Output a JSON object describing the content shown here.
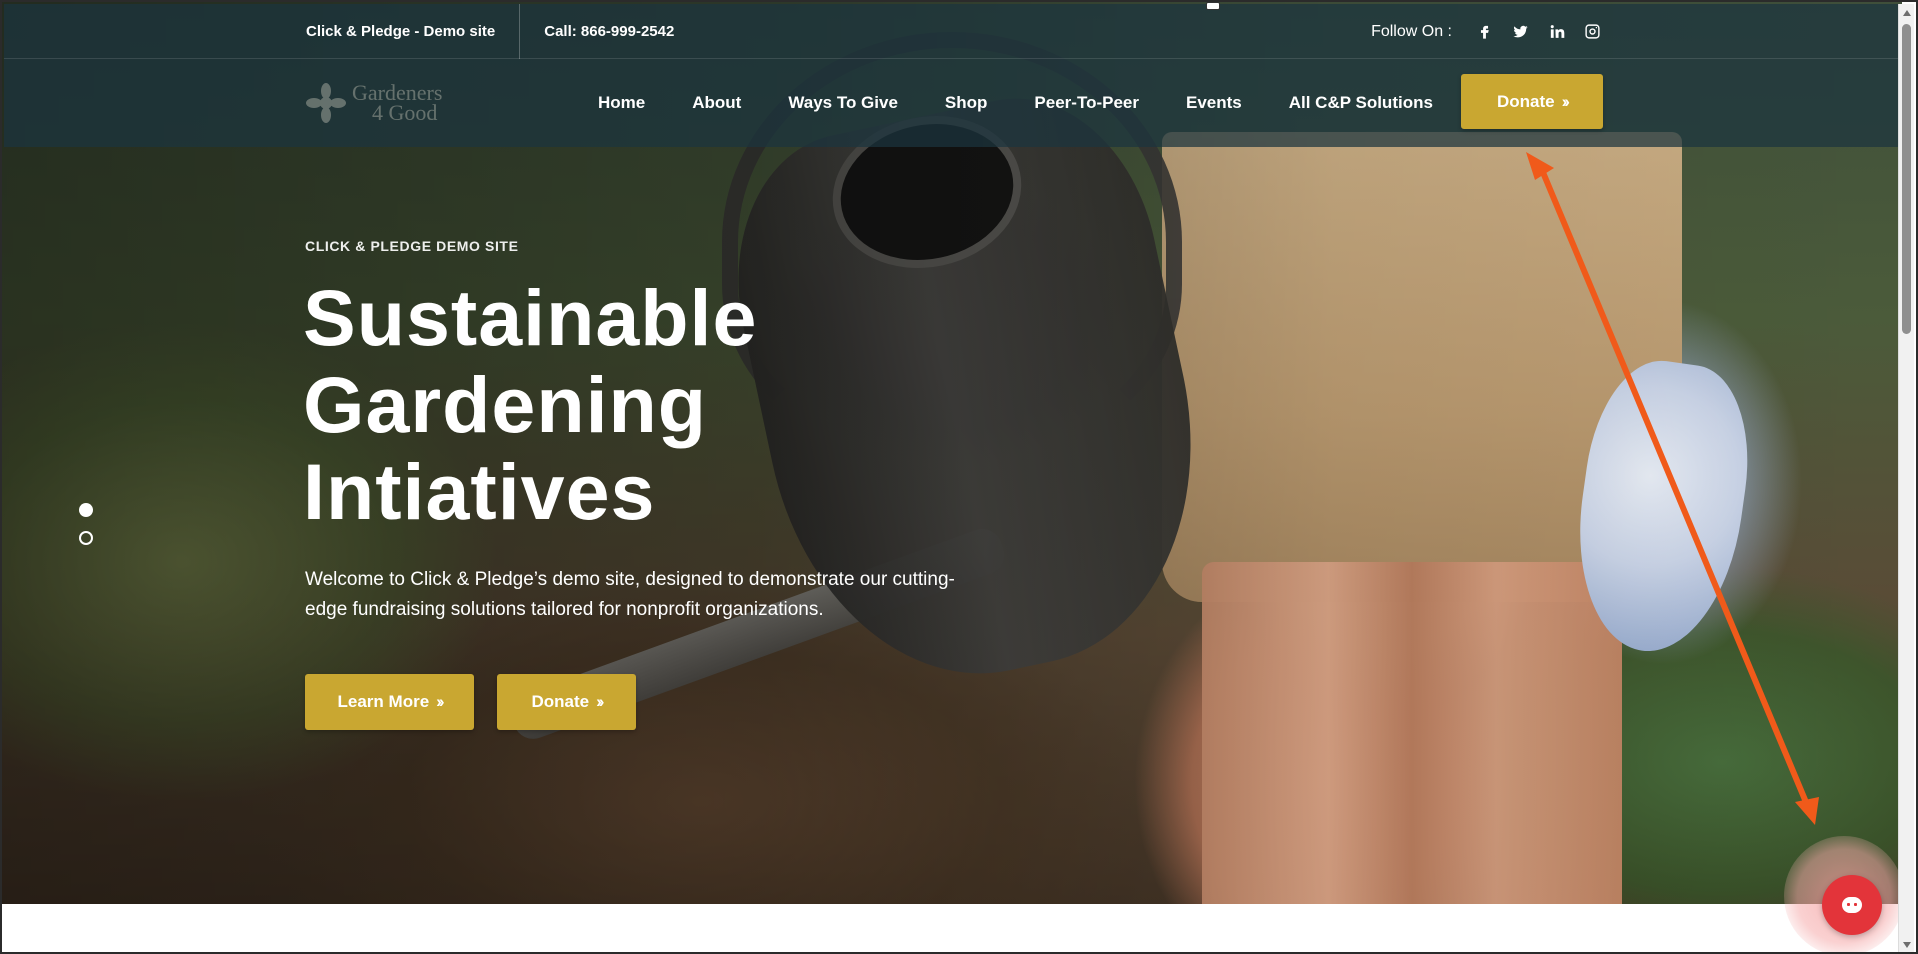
{
  "topbar": {
    "site_name": "Click & Pledge - Demo site",
    "phone": "Call: 866-999-2542",
    "follow_label": "Follow On :",
    "social_icons": [
      "facebook-icon",
      "twitter-icon",
      "linkedin-icon",
      "instagram-icon"
    ]
  },
  "logo": {
    "line1": "Gardeners",
    "line2": "4 Good"
  },
  "nav": {
    "items": [
      {
        "label": "Home"
      },
      {
        "label": "About"
      },
      {
        "label": "Ways To Give"
      },
      {
        "label": "Shop"
      },
      {
        "label": "Peer-To-Peer"
      },
      {
        "label": "Events"
      },
      {
        "label": "All C&P Solutions"
      }
    ],
    "donate_label": "Donate"
  },
  "hero": {
    "eyebrow": "CLICK & PLEDGE DEMO SITE",
    "title_lines": [
      "Sustainable",
      "Gardening",
      "Intiatives"
    ],
    "description": "Welcome to Click & Pledge’s demo site, designed to demonstrate our cutting-edge fundraising solutions tailored for nonprofit organizations.",
    "learn_more_label": "Learn More",
    "donate_label": "Donate",
    "slides_active": 1,
    "slides_total": 2
  },
  "colors": {
    "accent": "#c9a731",
    "header_overlay": "#1c343e",
    "chat_button": "#e3343a",
    "annotation_arrow": "#f05a1a"
  },
  "chat": {
    "icon": "chat-bot-icon"
  }
}
